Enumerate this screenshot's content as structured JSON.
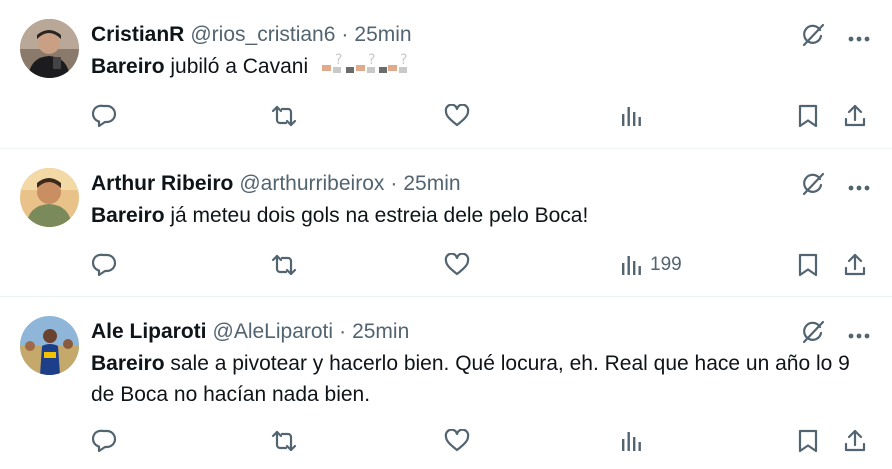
{
  "tweets": [
    {
      "name": "CristianR",
      "handle": "@rios_cristian6",
      "separator": "·",
      "time": "25min",
      "text_bold": "Bareiro",
      "text_rest": " jubiló a Cavani",
      "has_emoji": true,
      "views": ""
    },
    {
      "name": "Arthur Ribeiro",
      "handle": "@arthurribeirox",
      "separator": "·",
      "time": "25min",
      "text_bold": "Bareiro",
      "text_rest": " já meteu dois gols na estreia dele pelo Boca!",
      "has_emoji": false,
      "views": "199"
    },
    {
      "name": "Ale Liparoti",
      "handle": "@AleLiparoti",
      "separator": "·",
      "time": "25min",
      "text_bold": "Bareiro",
      "text_rest": " sale a pivotear y hacerlo bien. Qué locura, eh. Real que hace un año lo 9 de Boca no hacían nada bien.",
      "has_emoji": false,
      "views": ""
    }
  ],
  "colors": {
    "text": "#0f1419",
    "secondary": "#536471",
    "divider": "#eff3f4"
  },
  "icons": [
    "grok-slash-icon",
    "more-icon",
    "reply-icon",
    "retweet-icon",
    "like-icon",
    "views-icon",
    "bookmark-icon",
    "share-icon"
  ]
}
